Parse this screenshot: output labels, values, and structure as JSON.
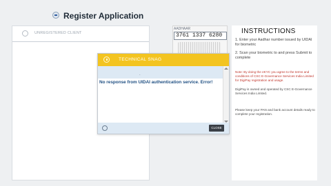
{
  "app": {
    "title": "Register Application"
  },
  "client": {
    "label": "UNREGISTERED CLIENT"
  },
  "aadhaar": {
    "label": "AADHAAR",
    "number": "3761 1337 6280"
  },
  "instructions": {
    "title": "INSTRUCTIONS",
    "steps": [
      "1. Enter your Aadhar number issued by UIDAI for biometric",
      "2. Scan your biometric to and press Submit to complete"
    ],
    "note": "Note: By doing the eKYC you agree to the terms and conditions of CSC E-Governance Services India Limited for DigiPay registration and usage.",
    "owner": "DigiPay is owned and operated by CSC E-Governance Services India Limited.",
    "keep": "Please keep your PAN and bank account details ready to complete your registration."
  },
  "dialog": {
    "title": "TECHNICAL SNAG",
    "dot": ".",
    "message": "No response from UIDAI authentication service. Error!",
    "close_label": "CLOSE"
  },
  "icons": {
    "app": "register-icon",
    "client": "client-icon",
    "dialog": "warning-icon",
    "footer": "fingerprint-icon"
  },
  "colors": {
    "dialog_header": "#f3c420",
    "message": "#1f4f82",
    "note": "#c0362c",
    "close_button": "#3a3f46"
  }
}
